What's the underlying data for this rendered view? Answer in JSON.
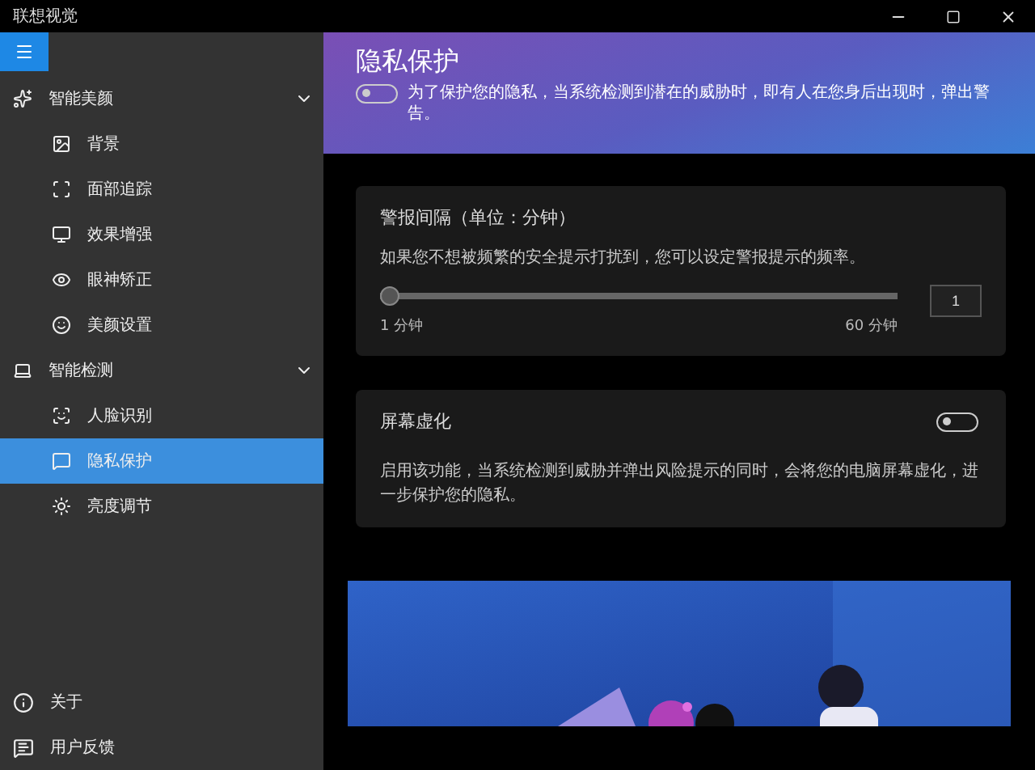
{
  "window": {
    "title": "联想视觉"
  },
  "sidebar": {
    "groups": [
      {
        "label": "智能美颜",
        "expanded": true,
        "children": [
          {
            "label": "背景",
            "selected": false
          },
          {
            "label": "面部追踪",
            "selected": false
          },
          {
            "label": "效果增强",
            "selected": false
          },
          {
            "label": "眼神矫正",
            "selected": false
          },
          {
            "label": "美颜设置",
            "selected": false
          }
        ]
      },
      {
        "label": "智能检测",
        "expanded": true,
        "children": [
          {
            "label": "人脸识别",
            "selected": false
          },
          {
            "label": "隐私保护",
            "selected": true
          },
          {
            "label": "亮度调节",
            "selected": false
          }
        ]
      }
    ],
    "footer": [
      {
        "label": "关于"
      },
      {
        "label": "用户反馈"
      }
    ]
  },
  "header": {
    "title": "隐私保护",
    "toggle": {
      "on": false
    },
    "description": "为了保护您的隐私，当系统检测到潜在的威胁时，即有人在您身后出现时，弹出警告。"
  },
  "cards": [
    {
      "kind": "slider",
      "title": "警报间隔（单位：分钟）",
      "description": "如果您不想被频繁的安全提示打扰到，您可以设定警报提示的频率。",
      "level": 0,
      "min_label": "1 分钟",
      "max_label": "60 分钟",
      "value": "1"
    },
    {
      "kind": "switch",
      "title": "屏幕虚化",
      "on": false,
      "description": "启用该功能，当系统检测到威胁并弹出风险提示的同时，会将您的电脑屏幕虚化，进一步保护您的隐私。"
    }
  ]
}
